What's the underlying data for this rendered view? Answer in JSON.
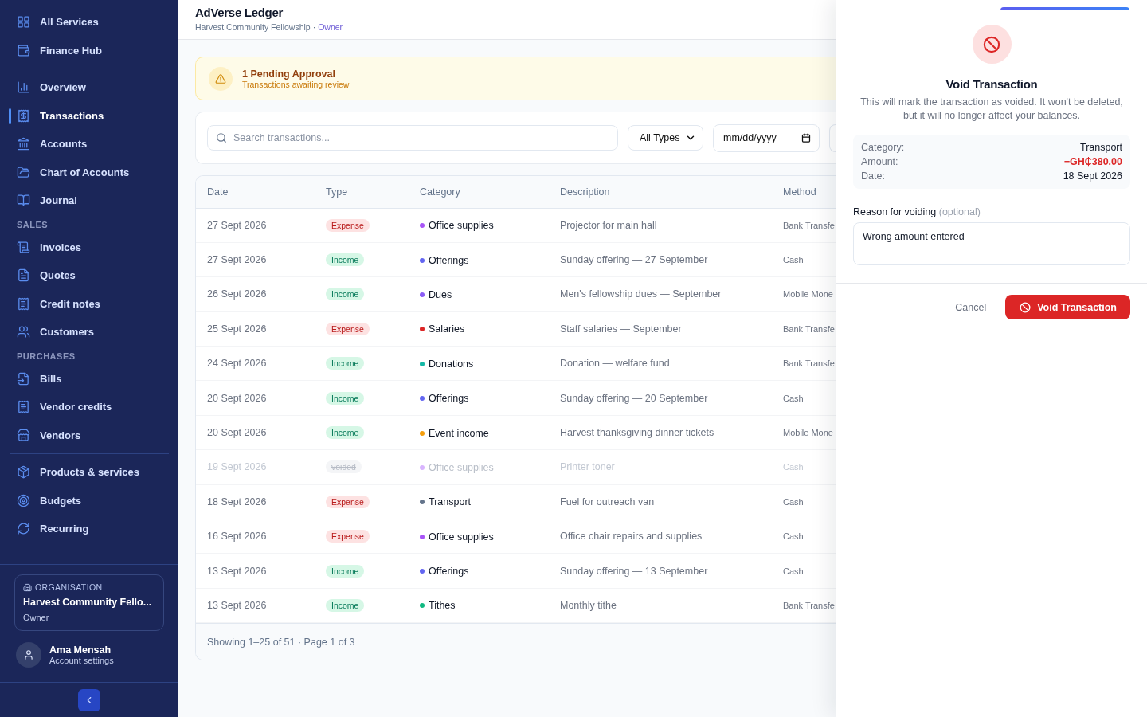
{
  "sidebar": {
    "groups": [
      {
        "items": [
          {
            "label": "All Services",
            "selected": false
          },
          {
            "label": "Finance Hub",
            "selected": false
          }
        ]
      },
      {
        "items": [
          {
            "label": "Overview",
            "selected": false
          },
          {
            "label": "Transactions",
            "selected": true
          },
          {
            "label": "Accounts",
            "selected": false
          },
          {
            "label": "Chart of Accounts",
            "selected": false
          },
          {
            "label": "Journal",
            "selected": false
          }
        ]
      },
      {
        "heading": "SALES",
        "items": [
          {
            "label": "Invoices",
            "selected": false
          },
          {
            "label": "Quotes",
            "selected": false
          },
          {
            "label": "Credit notes",
            "selected": false
          },
          {
            "label": "Customers",
            "selected": false
          }
        ]
      },
      {
        "heading": "PURCHASES",
        "items": [
          {
            "label": "Bills",
            "selected": false
          },
          {
            "label": "Vendor credits",
            "selected": false
          },
          {
            "label": "Vendors",
            "selected": false
          }
        ]
      },
      {
        "items": [
          {
            "label": "Products & services",
            "selected": false
          },
          {
            "label": "Budgets",
            "selected": false
          },
          {
            "label": "Recurring",
            "selected": false
          }
        ]
      }
    ],
    "organisation": {
      "caption": "ORGANISATION",
      "name": "Harvest Community Fello...",
      "role": "Owner"
    },
    "user": {
      "name": "Ama Mensah",
      "link": "Account settings"
    }
  },
  "header": {
    "title": "AdVerse Ledger",
    "org": "Harvest Community Fellowship ·",
    "role": "Owner"
  },
  "alert": {
    "title": "1 Pending Approval",
    "subtitle": "Transactions awaiting review"
  },
  "filters": {
    "search_placeholder": "Search transactions...",
    "type": "All Types",
    "date_placeholder": "mm/dd/yyyy"
  },
  "table": {
    "columns": [
      "Date",
      "Type",
      "Category",
      "Description",
      "Method"
    ],
    "rows": [
      {
        "date": "27 Sept 2026",
        "type": "Expense",
        "kind": "expense",
        "voided": false,
        "category": "Office supplies",
        "color": "#a855f7",
        "description": "Projector for main hall",
        "method": "Bank Transfe"
      },
      {
        "date": "27 Sept 2026",
        "type": "Income",
        "kind": "income",
        "voided": false,
        "category": "Offerings",
        "color": "#6366f1",
        "description": "Sunday offering — 27 September",
        "method": "Cash"
      },
      {
        "date": "26 Sept 2026",
        "type": "Income",
        "kind": "income",
        "voided": false,
        "category": "Dues",
        "color": "#8b5cf6",
        "description": "Men's fellowship dues — September",
        "method": "Mobile Mone"
      },
      {
        "date": "25 Sept 2026",
        "type": "Expense",
        "kind": "expense",
        "voided": false,
        "category": "Salaries",
        "color": "#dc2626",
        "description": "Staff salaries — September",
        "method": "Bank Transfe"
      },
      {
        "date": "24 Sept 2026",
        "type": "Income",
        "kind": "income",
        "voided": false,
        "category": "Donations",
        "color": "#14b8a6",
        "description": "Donation — welfare fund",
        "method": "Bank Transfe"
      },
      {
        "date": "20 Sept 2026",
        "type": "Income",
        "kind": "income",
        "voided": false,
        "category": "Offerings",
        "color": "#6366f1",
        "description": "Sunday offering — 20 September",
        "method": "Cash"
      },
      {
        "date": "20 Sept 2026",
        "type": "Income",
        "kind": "income",
        "voided": false,
        "category": "Event income",
        "color": "#f59e0b",
        "description": "Harvest thanksgiving dinner tickets",
        "method": "Mobile Mone"
      },
      {
        "date": "19 Sept 2026",
        "type": "voided",
        "kind": "voided",
        "voided": true,
        "category": "Office supplies",
        "color": "#d8b4fe",
        "description": "Printer toner",
        "method": "Cash"
      },
      {
        "date": "18 Sept 2026",
        "type": "Expense",
        "kind": "expense",
        "voided": false,
        "category": "Transport",
        "color": "#64748b",
        "description": "Fuel for outreach van",
        "method": "Cash"
      },
      {
        "date": "16 Sept 2026",
        "type": "Expense",
        "kind": "expense",
        "voided": false,
        "category": "Office supplies",
        "color": "#a855f7",
        "description": "Office chair repairs and supplies",
        "method": "Cash"
      },
      {
        "date": "13 Sept 2026",
        "type": "Income",
        "kind": "income",
        "voided": false,
        "category": "Offerings",
        "color": "#6366f1",
        "description": "Sunday offering — 13 September",
        "method": "Cash"
      },
      {
        "date": "13 Sept 2026",
        "type": "Income",
        "kind": "income",
        "voided": false,
        "category": "Tithes",
        "color": "#10b981",
        "description": "Monthly tithe",
        "method": "Bank Transfe"
      }
    ],
    "footer": "Showing 1–25 of 51 · Page 1 of 3"
  },
  "dialog": {
    "title": "Void Transaction",
    "message": "This will mark the transaction as voided. It won't be deleted, but it will no longer affect your balances.",
    "details": [
      {
        "label": "Category:",
        "value": "Transport",
        "kind": "plain"
      },
      {
        "label": "Amount:",
        "value": "−GH₵380.00",
        "kind": "negative"
      },
      {
        "label": "Date:",
        "value": "18 Sept 2026",
        "kind": "plain"
      }
    ],
    "reason_label": "Reason for voiding",
    "reason_hint": "(optional)",
    "reason_value": "Wrong amount entered",
    "cancel": "Cancel",
    "confirm": "Void Transaction"
  }
}
